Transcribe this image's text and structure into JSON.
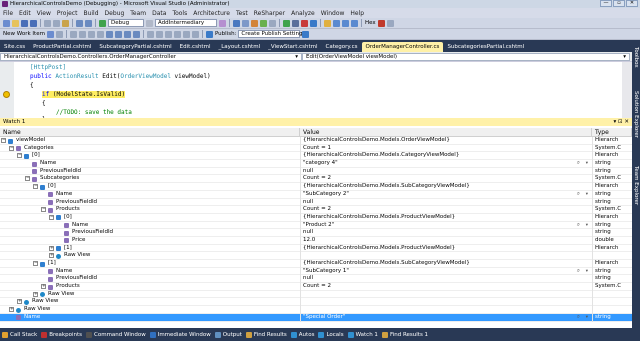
{
  "window": {
    "title": "HierarchicalControlsDemo (Debugging) - Microsoft Visual Studio (Administrator)",
    "controls": [
      "—",
      "▫",
      "✕"
    ]
  },
  "menu": [
    "File",
    "Edit",
    "View",
    "Project",
    "Build",
    "Debug",
    "Team",
    "Data",
    "Tools",
    "Architecture",
    "Test",
    "ReSharper",
    "Analyze",
    "Window",
    "Help"
  ],
  "toolbar": {
    "config_value": "Debug",
    "target_value": "AddIntermediary",
    "hex_label": "Hex",
    "new_work_item": "New Work Item",
    "publish_label": "Publish:",
    "publish_value": "Create Publish Settings"
  },
  "tabs": [
    {
      "label": "Site.css",
      "active": false
    },
    {
      "label": "ProductPartial.cshtml",
      "active": false
    },
    {
      "label": "SubcategoryPartial.cshtml",
      "active": false
    },
    {
      "label": "Edit.cshtml",
      "active": false
    },
    {
      "label": "_Layout.cshtml",
      "active": false
    },
    {
      "label": "_ViewStart.cshtml",
      "active": false
    },
    {
      "label": "Category.cs",
      "active": false
    },
    {
      "label": "OrderManagerController.cs",
      "active": true
    },
    {
      "label": "SubcategoriesPartial.cshtml",
      "active": false
    }
  ],
  "navbar": {
    "type_combo": "HierarchicalControlsDemo.Controllers.OrderManagerController",
    "member_combo": "Edit(OrderViewModel viewModel)"
  },
  "code": {
    "attr_line": "[HttpPost]",
    "sig_public": "public",
    "sig_actionresult": "ActionResult",
    "sig_edit": " Edit(",
    "sig_type": "OrderViewModel",
    "sig_param": " viewModel)",
    "brace_open": "{",
    "if_kw": "if",
    "if_cond": " (ModelState.IsValid)",
    "inner_brace": "{",
    "todo": "//TODO: save the data",
    "inner_close": "}"
  },
  "watch": {
    "title": "Watch 1",
    "window_controls": "▾ ⊡ ✕",
    "columns": {
      "name": "Name",
      "value": "Value",
      "type": "Type"
    },
    "rows": [
      {
        "name": "viewModel",
        "value": "{HierarchicalControlsDemo.Models.OrderViewModel}",
        "type": "Hierarch",
        "depth": 0,
        "expander": "−",
        "icon": "field",
        "selected": false
      },
      {
        "name": "Categories",
        "value": "Count = 1",
        "type": "System.C",
        "depth": 1,
        "expander": "−",
        "icon": "prop",
        "selected": false
      },
      {
        "name": "[0]",
        "value": "{HierarchicalControlsDemo.Models.CategoryViewModel}",
        "type": "Hierarch",
        "depth": 2,
        "expander": "−",
        "icon": "field",
        "selected": false
      },
      {
        "name": "Name",
        "value": "\"category 4\"",
        "type": "string",
        "depth": 3,
        "expander": "",
        "icon": "prop",
        "selected": false,
        "viewer": true
      },
      {
        "name": "PreviousFieldId",
        "value": "null",
        "type": "string",
        "depth": 3,
        "expander": "",
        "icon": "prop",
        "selected": false
      },
      {
        "name": "Subcategories",
        "value": "Count = 2",
        "type": "System.C",
        "depth": 3,
        "expander": "−",
        "icon": "prop",
        "selected": false
      },
      {
        "name": "[0]",
        "value": "{HierarchicalControlsDemo.Models.SubCategoryViewModel}",
        "type": "Hierarch",
        "depth": 4,
        "expander": "−",
        "icon": "field",
        "selected": false
      },
      {
        "name": "Name",
        "value": "\"SubCategory 2\"",
        "type": "string",
        "depth": 5,
        "expander": "",
        "icon": "prop",
        "selected": false,
        "viewer": true
      },
      {
        "name": "PreviousFieldId",
        "value": "null",
        "type": "string",
        "depth": 5,
        "expander": "",
        "icon": "prop",
        "selected": false
      },
      {
        "name": "Products",
        "value": "Count = 2",
        "type": "System.C",
        "depth": 5,
        "expander": "−",
        "icon": "prop",
        "selected": false
      },
      {
        "name": "[0]",
        "value": "{HierarchicalControlsDemo.Models.ProductViewModel}",
        "type": "Hierarch",
        "depth": 6,
        "expander": "−",
        "icon": "field",
        "selected": false
      },
      {
        "name": "Name",
        "value": "\"Product 2\"",
        "type": "string",
        "depth": 7,
        "expander": "",
        "icon": "prop",
        "selected": false,
        "viewer": true
      },
      {
        "name": "PreviousFieldId",
        "value": "null",
        "type": "string",
        "depth": 7,
        "expander": "",
        "icon": "prop",
        "selected": false
      },
      {
        "name": "Price",
        "value": "12.0",
        "type": "double",
        "depth": 7,
        "expander": "",
        "icon": "prop",
        "selected": false
      },
      {
        "name": "[1]",
        "value": "{HierarchicalControlsDemo.Models.ProductViewModel}",
        "type": "Hierarch",
        "depth": 6,
        "expander": "+",
        "icon": "field",
        "selected": false
      },
      {
        "name": "Raw View",
        "value": "",
        "type": "",
        "depth": 6,
        "expander": "+",
        "icon": "raw",
        "selected": false
      },
      {
        "name": "[1]",
        "value": "{HierarchicalControlsDemo.Models.SubCategoryViewModel}",
        "type": "Hierarch",
        "depth": 4,
        "expander": "−",
        "icon": "field",
        "selected": false
      },
      {
        "name": "Name",
        "value": "\"SubCategory 1\"",
        "type": "string",
        "depth": 5,
        "expander": "",
        "icon": "prop",
        "selected": false,
        "viewer": true
      },
      {
        "name": "PreviousFieldId",
        "value": "null",
        "type": "string",
        "depth": 5,
        "expander": "",
        "icon": "prop",
        "selected": false
      },
      {
        "name": "Products",
        "value": "Count = 2",
        "type": "System.C",
        "depth": 5,
        "expander": "+",
        "icon": "prop",
        "selected": false
      },
      {
        "name": "Raw View",
        "value": "",
        "type": "",
        "depth": 4,
        "expander": "+",
        "icon": "raw",
        "selected": false
      },
      {
        "name": "Raw View",
        "value": "",
        "type": "",
        "depth": 2,
        "expander": "+",
        "icon": "raw",
        "selected": false
      },
      {
        "name": "Raw View",
        "value": "",
        "type": "",
        "depth": 1,
        "expander": "+",
        "icon": "raw",
        "selected": false
      },
      {
        "name": "Name",
        "value": "\"Special Order\"",
        "type": "string",
        "depth": 1,
        "expander": "",
        "icon": "prop",
        "selected": true,
        "viewer": true
      }
    ]
  },
  "side_panels": [
    "Toolbox",
    "Solution Explorer",
    "Team Explorer"
  ],
  "bottom_tabs": [
    {
      "label": "Call Stack",
      "color": "#e0a030"
    },
    {
      "label": "Breakpoints",
      "color": "#c03030"
    },
    {
      "label": "Command Window",
      "color": "#505050"
    },
    {
      "label": "Immediate Window",
      "color": "#3070c0"
    },
    {
      "label": "Output",
      "color": "#6090c0"
    },
    {
      "label": "Find Results",
      "color": "#d0a040"
    },
    {
      "label": "Autos",
      "color": "#3090d0"
    },
    {
      "label": "Locals",
      "color": "#3090d0"
    },
    {
      "label": "Watch 1",
      "color": "#3090d0"
    },
    {
      "label": "Find Results 1",
      "color": "#d0a040"
    }
  ]
}
